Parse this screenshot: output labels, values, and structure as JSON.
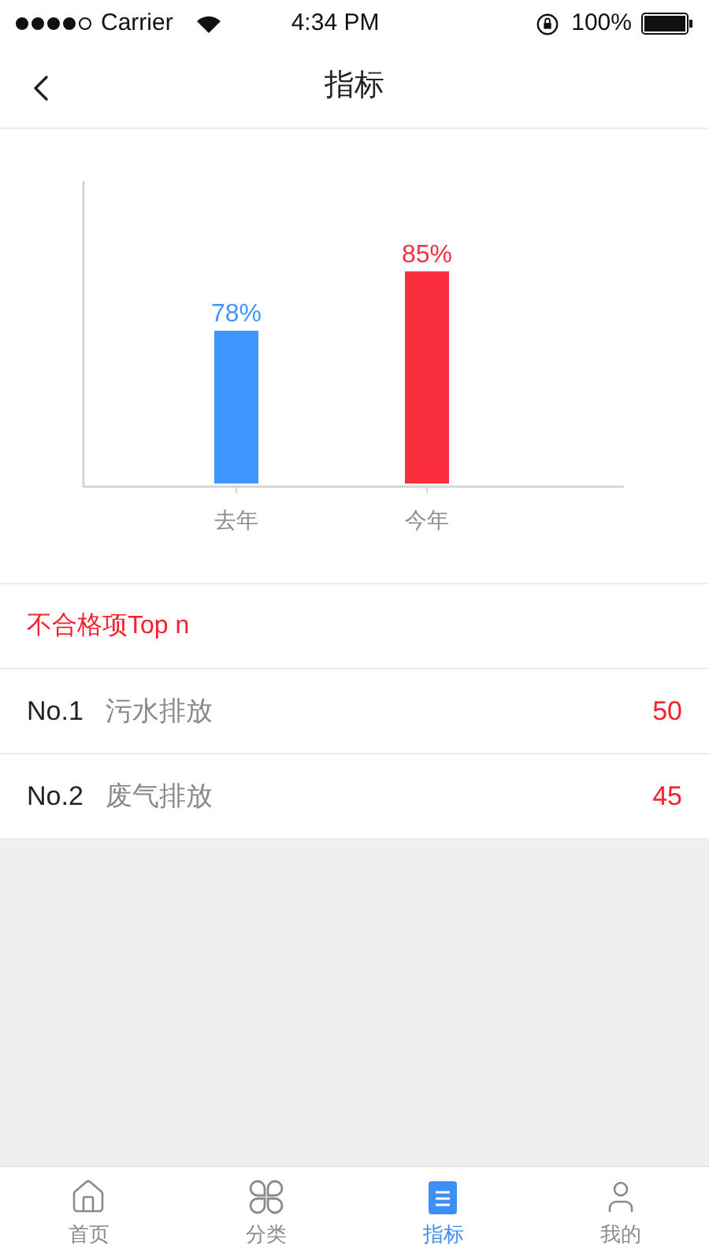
{
  "status_bar": {
    "carrier": "Carrier",
    "time": "4:34 PM",
    "battery": "100%"
  },
  "nav": {
    "title": "指标"
  },
  "chart_data": {
    "type": "bar",
    "categories": [
      "去年",
      "今年"
    ],
    "values": [
      78,
      85
    ],
    "colors": [
      "#4096ff",
      "#fb2e3d"
    ],
    "ylim": [
      60,
      96
    ],
    "data_labels": true,
    "value_labels": [
      "78%",
      "85%"
    ]
  },
  "failures": {
    "title": "不合格项Top n",
    "items": [
      {
        "rank": "No.1",
        "name": "污水排放",
        "count": "50"
      },
      {
        "rank": "No.2",
        "name": "废气排放",
        "count": "45"
      }
    ]
  },
  "tab_bar": [
    {
      "label": "首页",
      "kind": "home",
      "selected": false
    },
    {
      "label": "分类",
      "kind": "category",
      "selected": false
    },
    {
      "label": "指标",
      "kind": "metrics",
      "selected": true
    },
    {
      "label": "我的",
      "kind": "profile",
      "selected": false
    }
  ]
}
